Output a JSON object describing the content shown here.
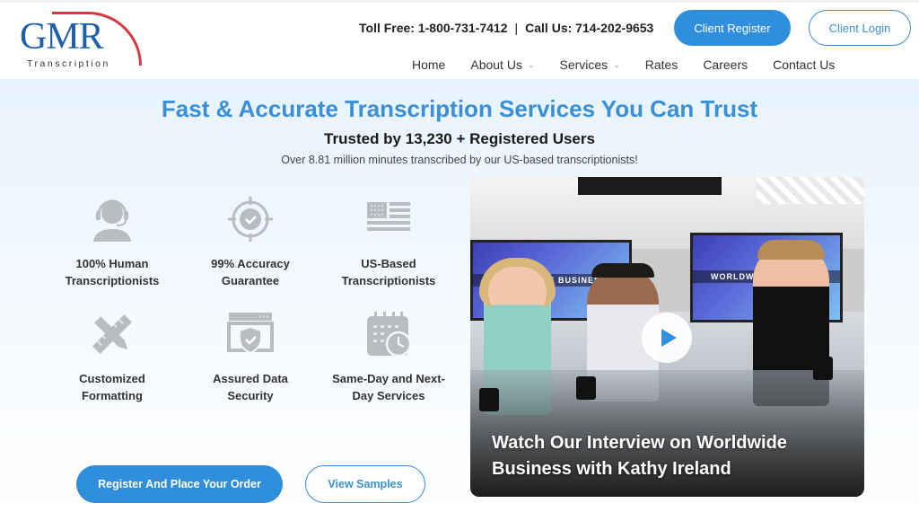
{
  "header": {
    "logo": {
      "brand": "GMR",
      "subtitle": "Transcription"
    },
    "contact": {
      "toll_free": "Toll Free: 1-800-731-7412",
      "separator": "|",
      "call_us": "Call Us: 714-202-9653"
    },
    "buttons": {
      "client_register": "Client Register",
      "client_login": "Client Login"
    },
    "nav": [
      {
        "label": "Home",
        "has_dropdown": false
      },
      {
        "label": "About Us",
        "has_dropdown": true
      },
      {
        "label": "Services",
        "has_dropdown": true
      },
      {
        "label": "Rates",
        "has_dropdown": false
      },
      {
        "label": "Careers",
        "has_dropdown": false
      },
      {
        "label": "Contact Us",
        "has_dropdown": false
      }
    ]
  },
  "hero": {
    "title": "Fast & Accurate Transcription Services You Can Trust",
    "subtitle": "Trusted by 13,230 + Registered Users",
    "note": "Over 8.81 million minutes transcribed by our US-based transcriptionists!",
    "features": [
      {
        "icon": "headset-person-icon",
        "label": "100% Human Transcriptionists"
      },
      {
        "icon": "target-check-icon",
        "label": "99% Accuracy Guarantee"
      },
      {
        "icon": "us-flag-icon",
        "label": "US-Based Transcriptionists"
      },
      {
        "icon": "pencil-ruler-icon",
        "label": "Customized Formatting"
      },
      {
        "icon": "shield-window-icon",
        "label": "Assured Data Security"
      },
      {
        "icon": "calendar-clock-icon",
        "label": "Same-Day and Next-Day Services"
      }
    ],
    "buttons": {
      "order": "Register And Place Your Order",
      "samples": "View Samples"
    },
    "video": {
      "screen_text": "WORLDWIDE BUSINESS",
      "caption": "Watch Our Interview on Worldwide Business with Kathy Ireland"
    }
  },
  "colors": {
    "accent": "#2f8fdc",
    "title_blue": "#3a8fd6",
    "logo_blue": "#1f5fa8",
    "logo_red": "#d63a40",
    "icon_gray": "#b9bcc0"
  }
}
